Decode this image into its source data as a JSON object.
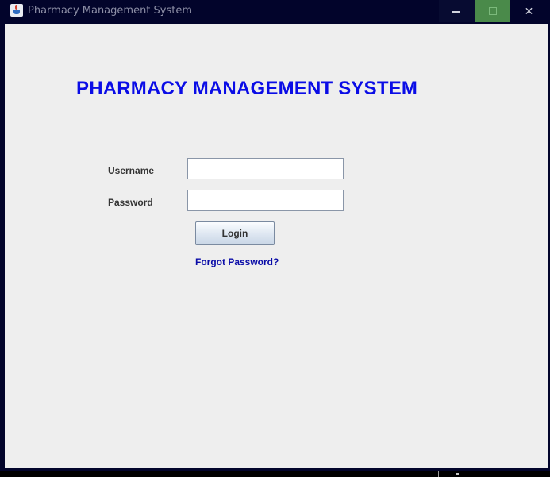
{
  "window": {
    "title": "Pharmacy Management System"
  },
  "title_buttons": {
    "minimize": "minimize",
    "maximize": "maximize",
    "close": "✕"
  },
  "login": {
    "heading": "PHARMACY MANAGEMENT SYSTEM",
    "username_label": "Username",
    "username_value": "",
    "password_label": "Password",
    "password_value": "",
    "login_button": "Login",
    "forgot_link": "Forgot Password?"
  },
  "colors": {
    "heading": "#0a0ce6",
    "link": "#0a0ca8",
    "titlebar": "#02042b",
    "content_bg": "#eeeeee",
    "maximize_hover": "#4a8a4a"
  }
}
